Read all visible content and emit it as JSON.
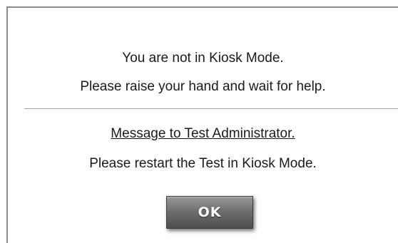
{
  "dialog": {
    "line1": "You are not in Kiosk Mode.",
    "line2": "Please raise your hand and wait for help.",
    "admin_heading": "Message to Test Administrator.",
    "admin_message": "Please restart the Test in Kiosk Mode.",
    "ok_label": "OK"
  },
  "colors": {
    "border": "#8a8a8a",
    "button_top": "#9a9a9a",
    "button_bottom": "#4f4f4f",
    "text": "#1a1a1a"
  }
}
